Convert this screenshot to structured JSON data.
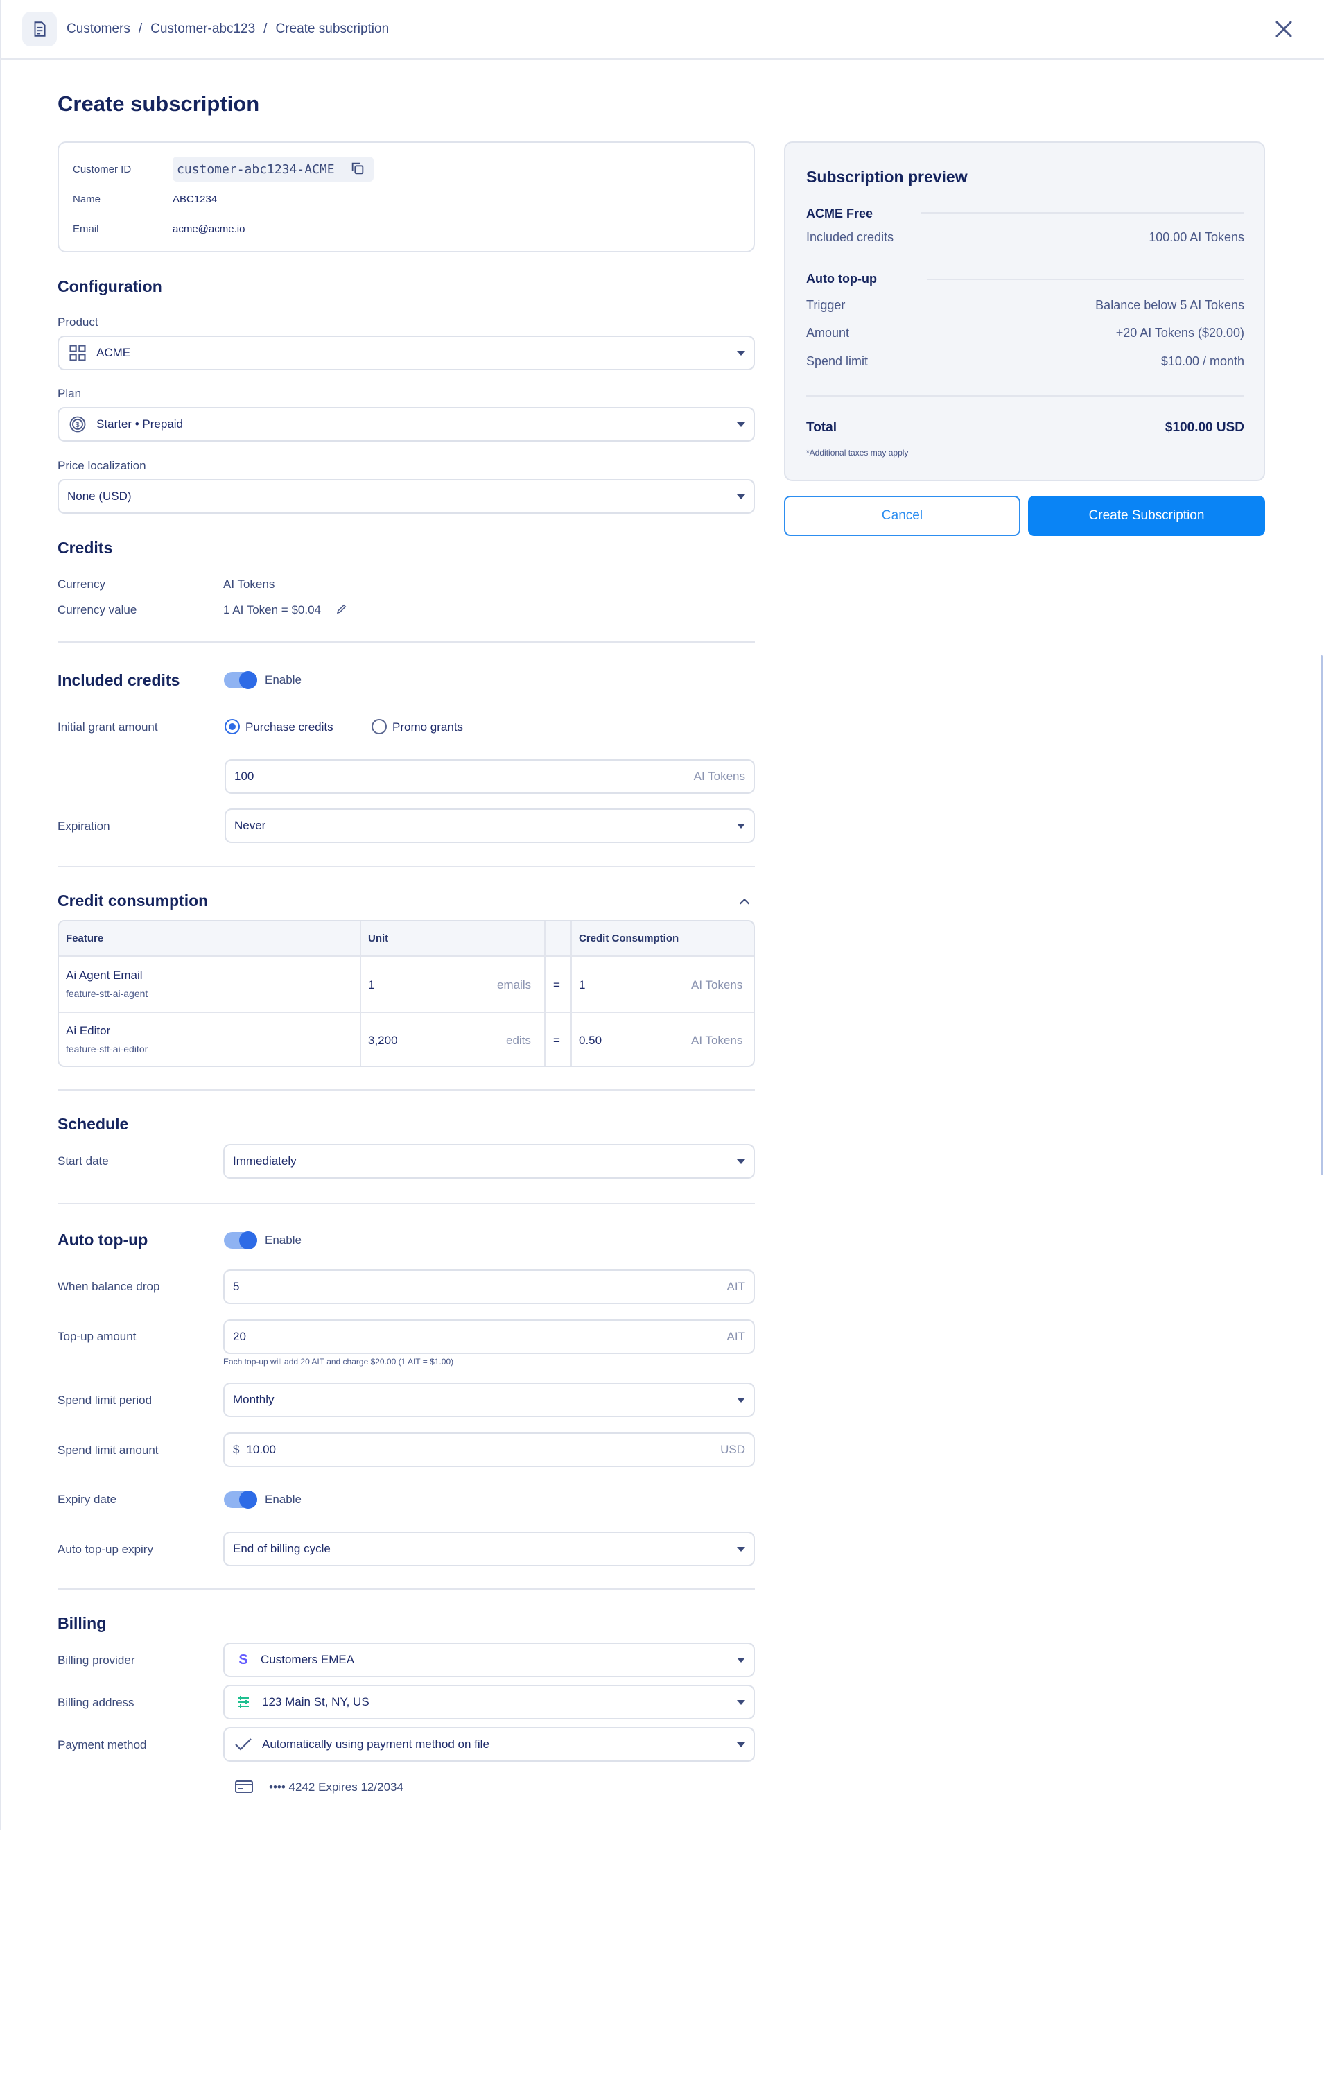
{
  "breadcrumb": [
    "Customers",
    "Customer-abc123",
    "Create subscription"
  ],
  "page_title": "Create subscription",
  "customer": {
    "id_label": "Customer ID",
    "id_value": "customer-abc1234-ACME",
    "name_label": "Name",
    "name_value": "ABC1234",
    "email_label": "Email",
    "email_value": "acme@acme.io"
  },
  "configuration": {
    "title": "Configuration",
    "product_label": "Product",
    "product_value": "ACME",
    "plan_label": "Plan",
    "plan_value": "Starter • Prepaid",
    "price_label": "Price localization",
    "price_value": "None (USD)"
  },
  "credits": {
    "title": "Credits",
    "currency_label": "Currency",
    "currency_value": "AI Tokens",
    "currency_value_label": "Currency value",
    "currency_value_value": "1 AI Token = $0.04"
  },
  "included_credits": {
    "title": "Included credits",
    "toggle_label": "Enable",
    "grant_label": "Initial grant amount",
    "radio_purchase": "Purchase credits",
    "radio_promo": "Promo grants",
    "amount": "100",
    "amount_unit": "AI Tokens",
    "expiration_label": "Expiration",
    "expiration_value": "Never"
  },
  "consumption": {
    "title": "Credit consumption",
    "headers": [
      "Feature",
      "Unit",
      "Credit Consumption"
    ],
    "rows": [
      {
        "name": "Ai Agent Email",
        "key": "feature-stt-ai-agent",
        "unit_value": "1",
        "unit": "emails",
        "eq": "=",
        "credit": "1",
        "credit_unit": "AI Tokens"
      },
      {
        "name": "Ai Editor",
        "key": "feature-stt-ai-editor",
        "unit_value": "3,200",
        "unit": "edits",
        "eq": "=",
        "credit": "0.50",
        "credit_unit": "AI Tokens"
      }
    ]
  },
  "schedule": {
    "title": "Schedule",
    "start_label": "Start date",
    "start_value": "Immediately"
  },
  "auto_topup": {
    "title": "Auto top-up",
    "toggle_label": "Enable",
    "balance_label": "When balance drop",
    "balance_value": "5",
    "balance_unit": "AIT",
    "amount_label": "Top-up amount",
    "amount_value": "20",
    "amount_unit": "AIT",
    "amount_hint": "Each top-up will add 20 AIT and charge $20.00 (1 AIT = $1.00)",
    "period_label": "Spend limit period",
    "period_value": "Monthly",
    "limit_label": "Spend limit amount",
    "limit_prefix": "$",
    "limit_value": "10.00",
    "limit_unit": "USD",
    "expiry_label": "Expiry date",
    "expiry_toggle": "Enable",
    "topup_expiry_label": "Auto top-up expiry",
    "topup_expiry_value": "End of billing cycle"
  },
  "billing": {
    "title": "Billing",
    "provider_label": "Billing provider",
    "provider_value": "Customers EMEA",
    "address_label": "Billing address",
    "address_value": "123 Main St, NY, US",
    "method_label": "Payment method",
    "method_value": "Automatically using payment method on file",
    "card_value": "•••• 4242 Expires 12/2034"
  },
  "preview": {
    "title": "Subscription preview",
    "plan_head": "ACME Free",
    "included_label": "Included credits",
    "included_value": "100.00 AI Tokens",
    "topup_head": "Auto top-up",
    "trigger_label": "Trigger",
    "trigger_value": "Balance below 5 AI Tokens",
    "amount_label": "Amount",
    "amount_value": "+20 AI Tokens ($20.00)",
    "limit_label": "Spend limit",
    "limit_value": "$10.00 / month",
    "total_label": "Total",
    "total_value": "$100.00 USD",
    "tax_note": "*Additional taxes may apply"
  },
  "actions": {
    "cancel": "Cancel",
    "create": "Create Subscription"
  },
  "colors": {
    "primary": "#0a84f5",
    "text": "#1e2b6a",
    "toggle": "#2d6be6"
  }
}
